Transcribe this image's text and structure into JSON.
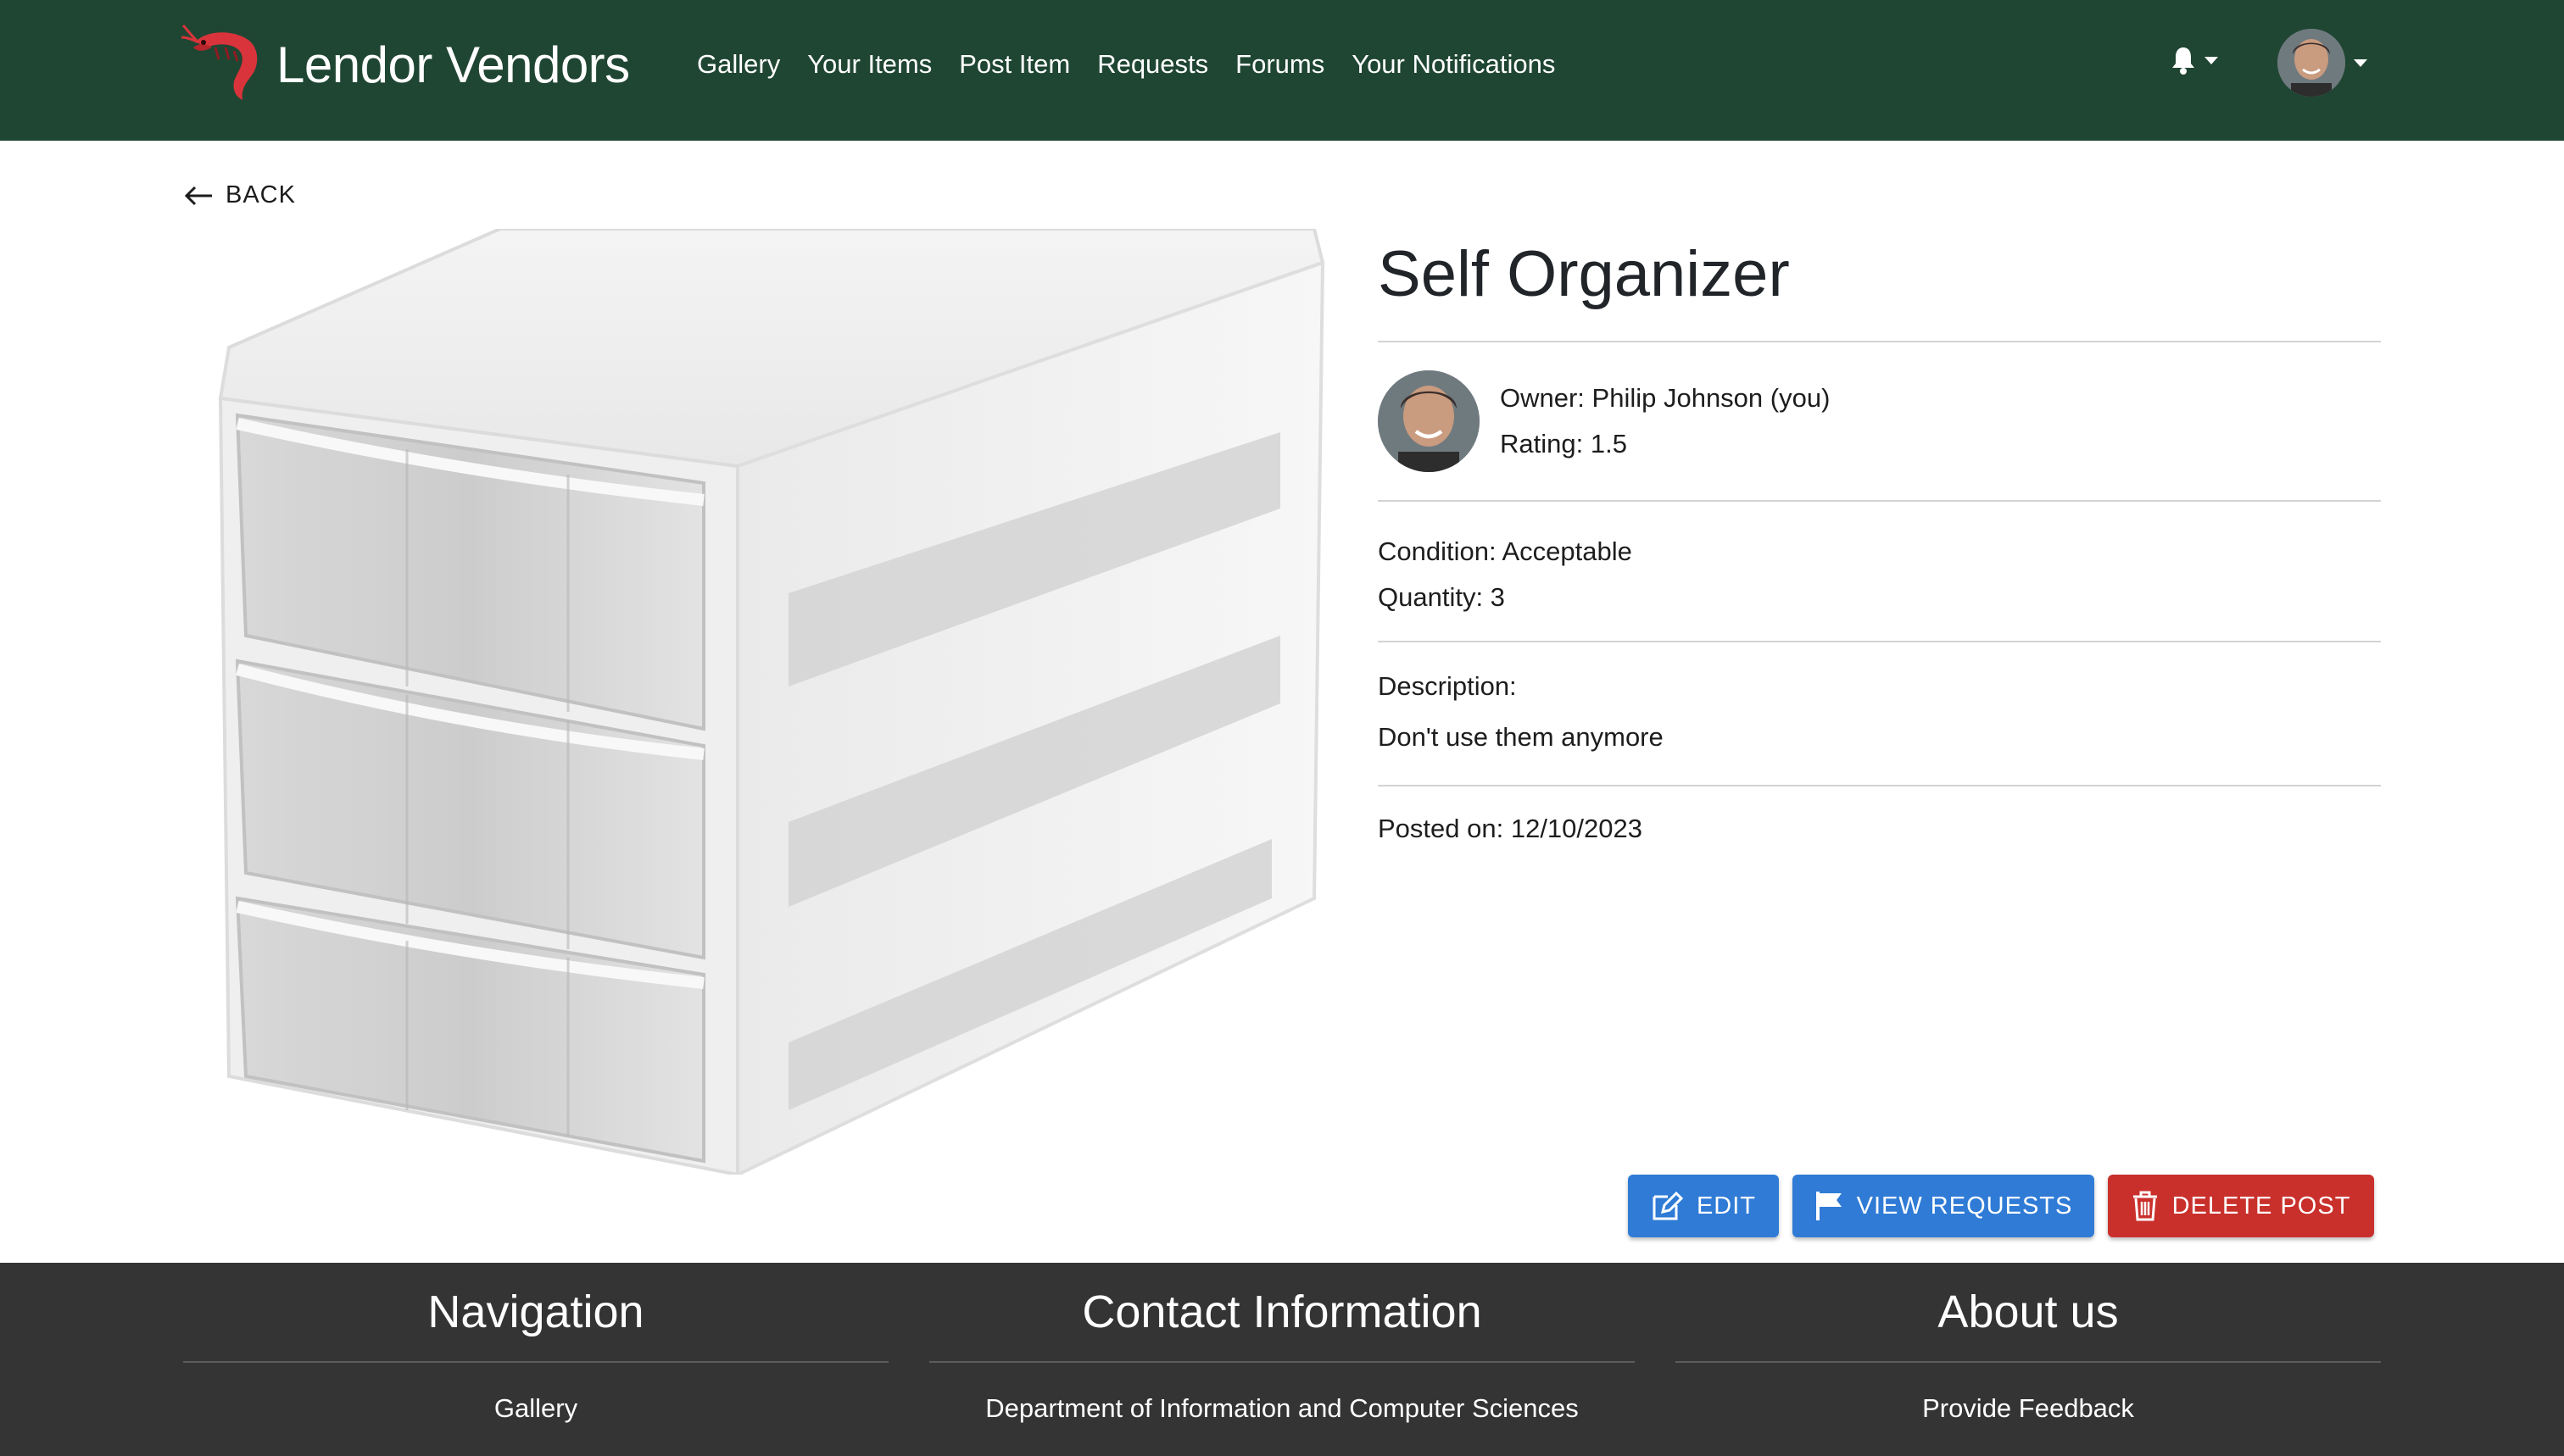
{
  "header": {
    "brand": "Lendor Vendors",
    "nav": [
      "Gallery",
      "Your Items",
      "Post Item",
      "Requests",
      "Forums",
      "Your Notifications"
    ],
    "colors": {
      "bar": "#1f4633",
      "logo": "#d9343b"
    }
  },
  "back": {
    "label": "BACK"
  },
  "item": {
    "title": "Self Organizer",
    "owner": "Owner: Philip Johnson (you)",
    "rating": "Rating: 1.5",
    "condition": "Condition: Acceptable",
    "quantity": "Quantity: 3",
    "description_label": "Description:",
    "description": "Don't use them anymore",
    "posted": "Posted on: 12/10/2023"
  },
  "actions": {
    "edit": "EDIT",
    "view_requests": "VIEW REQUESTS",
    "delete": "DELETE POST",
    "colors": {
      "primary": "#2f7bd6",
      "danger": "#c9302c"
    }
  },
  "footer": {
    "navigation": {
      "title": "Navigation",
      "first": "Gallery"
    },
    "contact": {
      "title": "Contact Information",
      "first": "Department of Information and Computer Sciences"
    },
    "about": {
      "title": "About us",
      "first": "Provide Feedback"
    }
  }
}
